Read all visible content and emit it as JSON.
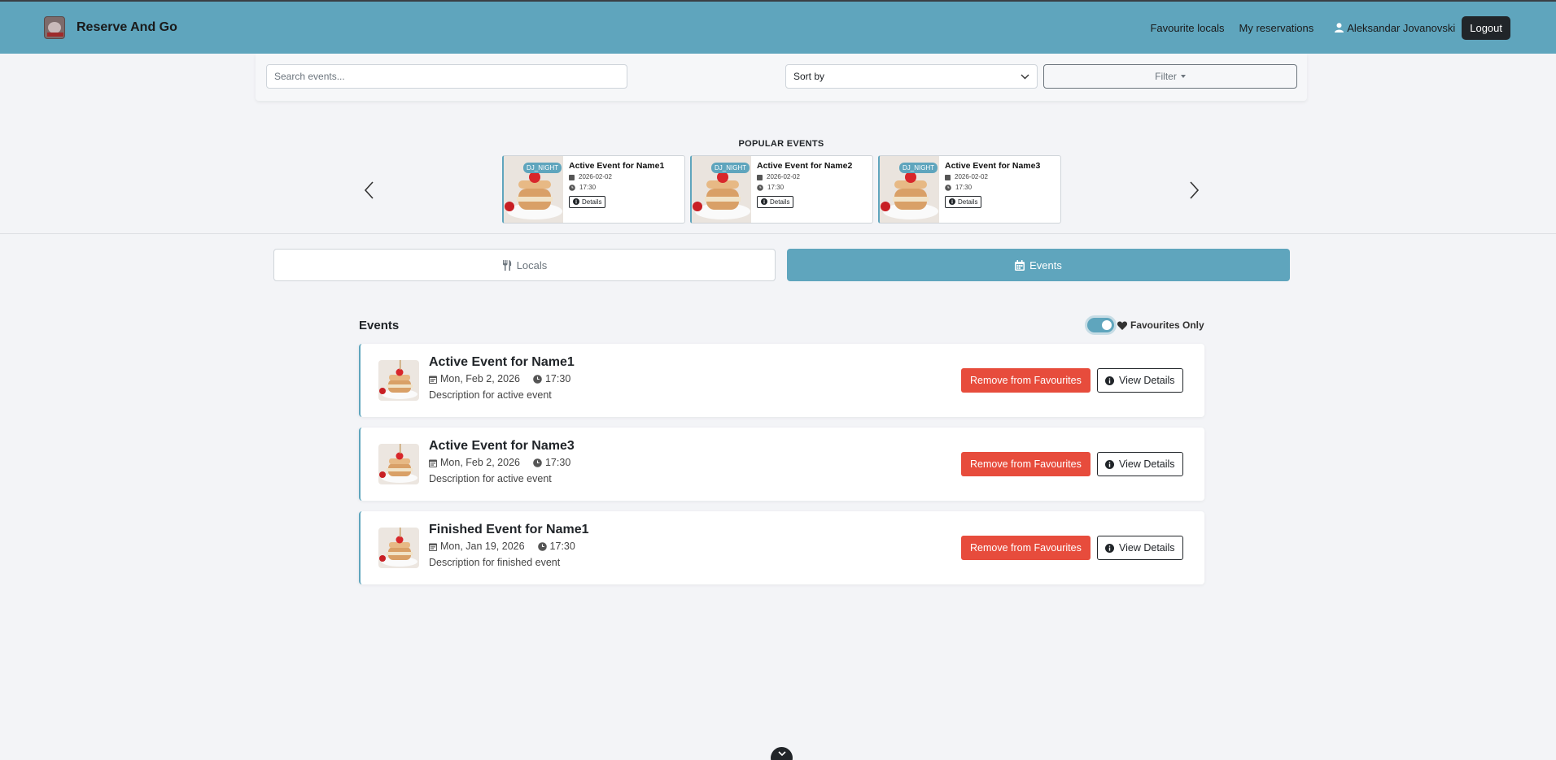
{
  "navbar": {
    "brand": "Reserve And Go",
    "links": [
      "Favourite locals",
      "My reservations"
    ],
    "user_name": "Aleksandar Jovanovski",
    "logout_label": "Logout"
  },
  "filters": {
    "search_placeholder": "Search events...",
    "sort_label": "Sort by",
    "filter_label": "Filter"
  },
  "popular": {
    "title": "POPULAR EVENTS",
    "events": [
      {
        "name": "Active Event for Name1",
        "tag": "DJ_NIGHT",
        "date": "2026-02-02",
        "time": "17:30",
        "details_label": "Details"
      },
      {
        "name": "Active Event for Name2",
        "tag": "DJ_NIGHT",
        "date": "2026-02-02",
        "time": "17:30",
        "details_label": "Details"
      },
      {
        "name": "Active Event for Name3",
        "tag": "DJ_NIGHT",
        "date": "2026-02-02",
        "time": "17:30",
        "details_label": "Details"
      }
    ]
  },
  "tabs": {
    "locals": "Locals",
    "events": "Events"
  },
  "events_section": {
    "heading": "Events",
    "favourites_only_label": "Favourites Only",
    "favourites_only_on": true,
    "items": [
      {
        "title": "Active Event for Name1",
        "date": "Mon, Feb 2, 2026",
        "time": "17:30",
        "description": "Description for active event",
        "remove_label": "Remove from Favourites",
        "view_label": "View Details"
      },
      {
        "title": "Active Event for Name3",
        "date": "Mon, Feb 2, 2026",
        "time": "17:30",
        "description": "Description for active event",
        "remove_label": "Remove from Favourites",
        "view_label": "View Details"
      },
      {
        "title": "Finished Event for Name1",
        "date": "Mon, Jan 19, 2026",
        "time": "17:30",
        "description": "Description for finished event",
        "remove_label": "Remove from Favourites",
        "view_label": "View Details"
      }
    ]
  },
  "colors": {
    "primary": "#5fa5bd",
    "danger": "#e74c3c",
    "dark": "#212529",
    "background": "#f3f4f7"
  },
  "icons": {
    "user": "user-icon",
    "calendar": "calendar-icon",
    "clock": "clock-icon",
    "info": "info-icon",
    "heart": "heart-icon",
    "utensils": "utensils-icon",
    "chevron": "chevron-down-icon"
  }
}
